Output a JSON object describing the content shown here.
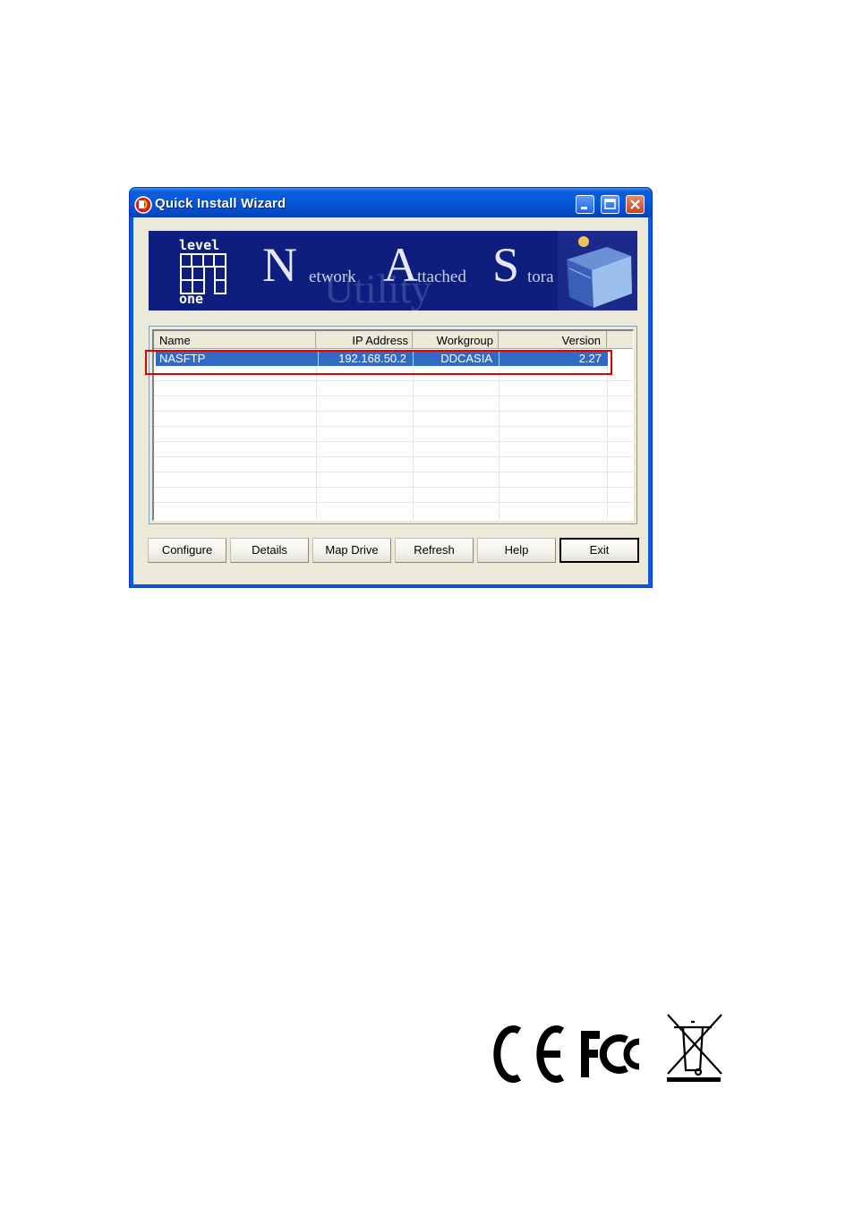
{
  "window": {
    "title": "Quick Install Wizard"
  },
  "banner": {
    "logo_top": "level",
    "logo_bottom": "one",
    "big_letters": [
      "N",
      "A",
      "S"
    ],
    "words": [
      "etwork",
      "ttached",
      "tora"
    ],
    "watermark": "Utility"
  },
  "list": {
    "columns": [
      "Name",
      "IP Address",
      "Workgroup",
      "Version"
    ],
    "rows": [
      {
        "name": "NASFTP",
        "ip": "192.168.50.2",
        "workgroup": "DDCASIA",
        "version": "2.27"
      }
    ]
  },
  "buttons": {
    "configure": "Configure",
    "details": "Details",
    "map_drive": "Map Drive",
    "refresh": "Refresh",
    "help": "Help",
    "exit": "Exit"
  },
  "colors": {
    "title_bar": "#0556d6",
    "selection": "#316ac5",
    "highlight_box": "#e00000",
    "banner_bg": "#0d1e7e"
  },
  "marks": [
    "CE",
    "FC",
    "weee-bin"
  ]
}
